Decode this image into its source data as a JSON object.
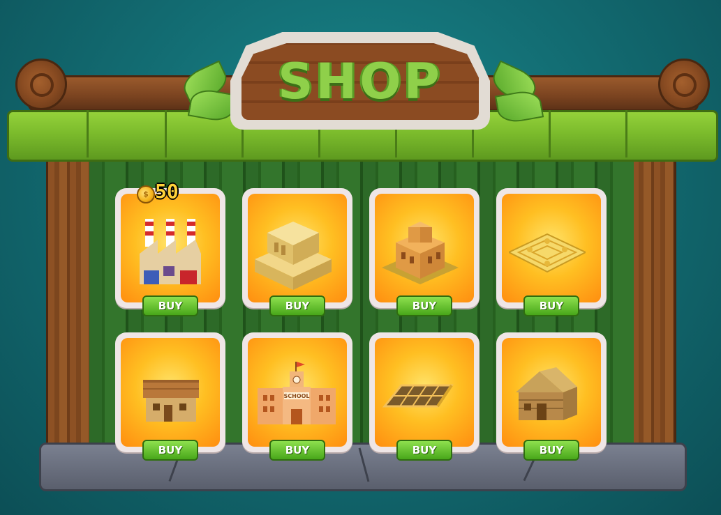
{
  "shop": {
    "title": "SHOP",
    "currency": {
      "icon": "coin-icon",
      "symbol": "$",
      "amount": "50"
    },
    "items": [
      {
        "icon": "factory-icon",
        "buy_label": "BUY"
      },
      {
        "icon": "sandstone-building-icon",
        "buy_label": "BUY"
      },
      {
        "icon": "brick-tower-building-icon",
        "buy_label": "BUY"
      },
      {
        "icon": "park-plot-icon",
        "buy_label": "BUY"
      },
      {
        "icon": "house-icon",
        "buy_label": "BUY"
      },
      {
        "icon": "school-icon",
        "buy_label": "BUY",
        "sign_text": "SCHOOL"
      },
      {
        "icon": "solar-panel-icon",
        "buy_label": "BUY"
      },
      {
        "icon": "wooden-cabin-icon",
        "buy_label": "BUY"
      }
    ]
  },
  "colors": {
    "background": "#136e74",
    "roof_green": "#7bbb2c",
    "wood_brown": "#7a4320",
    "card_orange": "#ffbf22",
    "buy_green": "#48a71a",
    "title_green": "#8fd04a",
    "coin_gold": "#ffd23a"
  }
}
